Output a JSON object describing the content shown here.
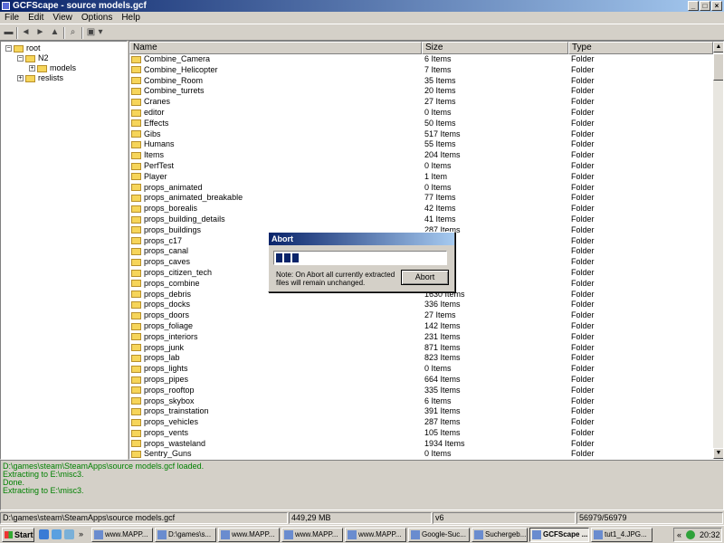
{
  "window": {
    "title": "GCFScape - source models.gcf"
  },
  "menu": [
    "File",
    "Edit",
    "View",
    "Options",
    "Help"
  ],
  "tree": {
    "root": "root",
    "n2": "N2",
    "models": "models",
    "reslists": "reslists"
  },
  "list": {
    "columns": {
      "name": "Name",
      "size": "Size",
      "type": "Type"
    },
    "rows": [
      {
        "name": "Combine_Camera",
        "size": "6 Items",
        "type": "Folder"
      },
      {
        "name": "Combine_Helicopter",
        "size": "7 Items",
        "type": "Folder"
      },
      {
        "name": "Combine_Room",
        "size": "35 Items",
        "type": "Folder"
      },
      {
        "name": "Combine_turrets",
        "size": "20 Items",
        "type": "Folder"
      },
      {
        "name": "Cranes",
        "size": "27 Items",
        "type": "Folder"
      },
      {
        "name": "editor",
        "size": "0 Items",
        "type": "Folder"
      },
      {
        "name": "Effects",
        "size": "50 Items",
        "type": "Folder"
      },
      {
        "name": "Gibs",
        "size": "517 Items",
        "type": "Folder"
      },
      {
        "name": "Humans",
        "size": "55 Items",
        "type": "Folder"
      },
      {
        "name": "Items",
        "size": "204 Items",
        "type": "Folder"
      },
      {
        "name": "PerfTest",
        "size": "0 Items",
        "type": "Folder"
      },
      {
        "name": "Player",
        "size": "1 Item",
        "type": "Folder"
      },
      {
        "name": "props_animated",
        "size": "0 Items",
        "type": "Folder"
      },
      {
        "name": "props_animated_breakable",
        "size": "77 Items",
        "type": "Folder"
      },
      {
        "name": "props_borealis",
        "size": "42 Items",
        "type": "Folder"
      },
      {
        "name": "props_building_details",
        "size": "41 Items",
        "type": "Folder"
      },
      {
        "name": "props_buildings",
        "size": "287 Items",
        "type": "Folder"
      },
      {
        "name": "props_c17",
        "size": "",
        "type": "Folder"
      },
      {
        "name": "props_canal",
        "size": "",
        "type": "Folder"
      },
      {
        "name": "props_caves",
        "size": "",
        "type": "Folder"
      },
      {
        "name": "props_citizen_tech",
        "size": "",
        "type": "Folder"
      },
      {
        "name": "props_combine",
        "size": "",
        "type": "Folder"
      },
      {
        "name": "props_debris",
        "size": "1630 Items",
        "type": "Folder"
      },
      {
        "name": "props_docks",
        "size": "336 Items",
        "type": "Folder"
      },
      {
        "name": "props_doors",
        "size": "27 Items",
        "type": "Folder"
      },
      {
        "name": "props_foliage",
        "size": "142 Items",
        "type": "Folder"
      },
      {
        "name": "props_interiors",
        "size": "231 Items",
        "type": "Folder"
      },
      {
        "name": "props_junk",
        "size": "871 Items",
        "type": "Folder"
      },
      {
        "name": "props_lab",
        "size": "823 Items",
        "type": "Folder"
      },
      {
        "name": "props_lights",
        "size": "0 Items",
        "type": "Folder"
      },
      {
        "name": "props_pipes",
        "size": "664 Items",
        "type": "Folder"
      },
      {
        "name": "props_rooftop",
        "size": "335 Items",
        "type": "Folder"
      },
      {
        "name": "props_skybox",
        "size": "6 Items",
        "type": "Folder"
      },
      {
        "name": "props_trainstation",
        "size": "391 Items",
        "type": "Folder"
      },
      {
        "name": "props_vehicles",
        "size": "287 Items",
        "type": "Folder"
      },
      {
        "name": "props_vents",
        "size": "105 Items",
        "type": "Folder"
      },
      {
        "name": "props_wasteland",
        "size": "1934 Items",
        "type": "Folder"
      },
      {
        "name": "Sentry_Guns",
        "size": "0 Items",
        "type": "Folder"
      }
    ]
  },
  "log": [
    "D:\\games\\steam\\SteamApps\\source models.gcf loaded.",
    "Extracting to E:\\misc3.",
    "Done.",
    "Extracting to E:\\misc3."
  ],
  "status": {
    "path": "D:\\games\\steam\\SteamApps\\source models.gcf",
    "size": "449,29 MB",
    "version": "v6",
    "blocks": "56979/56979"
  },
  "dialog": {
    "title": "Abort",
    "progress_blocks": 3,
    "note": "Note: On Abort all currently extracted files will remain unchanged.",
    "button": "Abort"
  },
  "taskbar": {
    "start": "Start",
    "chevron": "»",
    "tasks": [
      "www.MAPP...",
      "D:\\games\\s...",
      "www.MAPP...",
      "www.MAPP...",
      "www.MAPP...",
      "Google-Suc...",
      "Suchergeb...",
      "GCFScape ...",
      "tut1_4.JPG..."
    ],
    "tray_chevron": "«",
    "clock": "20:32"
  }
}
